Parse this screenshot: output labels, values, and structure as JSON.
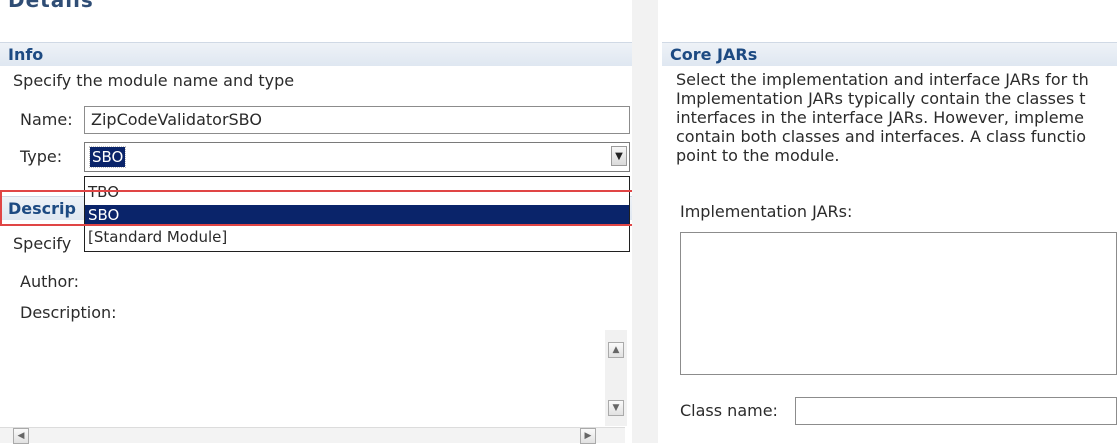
{
  "header": {
    "partial_title": "Details"
  },
  "info": {
    "section_title": "Info",
    "instruction": "Specify the module name and type",
    "name_label": "Name:",
    "name_value": "ZipCodeValidatorSBO",
    "type_label": "Type:",
    "type_value": "SBO",
    "type_options": [
      "TBO",
      "SBO",
      "[Standard Module]"
    ],
    "type_options_selected_index": 1
  },
  "description": {
    "section_title_visible": "Descrip",
    "instruction_visible": "Specify",
    "author_label": "Author:",
    "description_label": "Description:"
  },
  "core_jars": {
    "section_title": "Core JARs",
    "help_lines": [
      "Select the implementation and interface JARs for th",
      "Implementation JARs typically contain the classes t",
      "interfaces in the interface JARs. However, impleme",
      "contain both classes and interfaces. A class functio",
      "point to the module."
    ],
    "implementation_jars_label": "Implementation JARs:",
    "class_name_label": "Class name:",
    "class_name_value": ""
  },
  "icons": {
    "dropdown": "chevron-down-icon",
    "scroll_up": "arrow-up-icon",
    "scroll_down": "arrow-down-icon",
    "scroll_left": "arrow-left-icon",
    "scroll_right": "arrow-right-icon"
  },
  "colors": {
    "section_title": "#1d4a82",
    "selection": "#0a246a",
    "callout": "#e04545"
  }
}
